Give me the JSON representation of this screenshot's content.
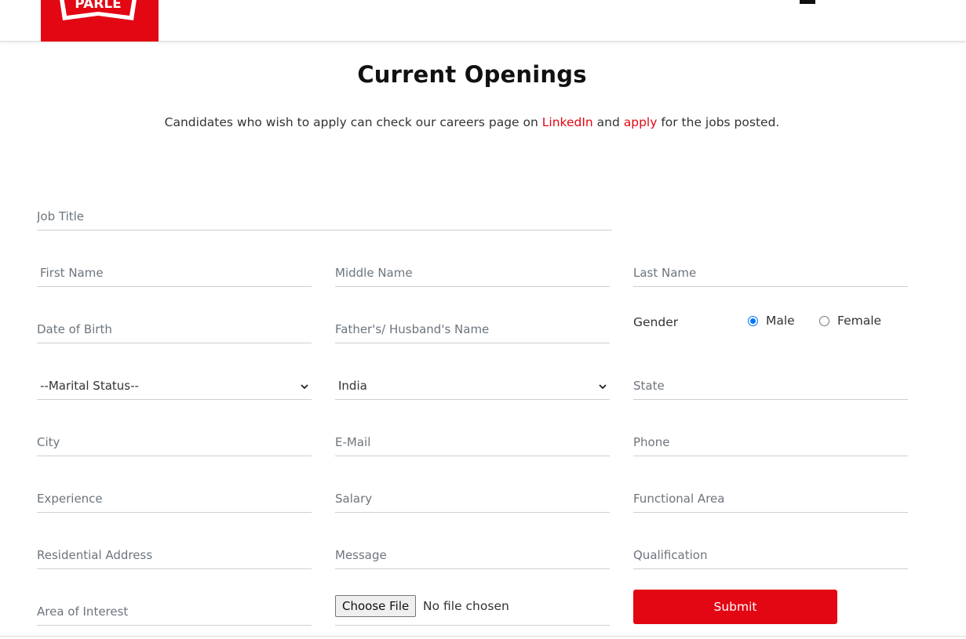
{
  "header": {
    "logo_text": "PARLE",
    "menu_icon": "hamburger-menu-icon",
    "brand_color": "#e30613"
  },
  "page": {
    "title": "Current Openings",
    "subtitle_before": "Candidates who wish to apply can check our careers page on ",
    "linkedin_link": "LinkedIn",
    "subtitle_middle": " and ",
    "apply_link": "apply",
    "subtitle_after": " for the jobs posted."
  },
  "form": {
    "job_title": "Job Title",
    "first_name": "First Name",
    "middle_name": "Middle Name",
    "last_name": "Last Name",
    "dob": "Date of Birth",
    "father_husband": "Father's/ Husband's Name",
    "gender_label": "Gender",
    "gender_options": [
      "Male",
      "Female"
    ],
    "gender_selected": "Male",
    "marital_status": "--Marital Status--",
    "country": "India",
    "state": "State",
    "city": "City",
    "email": "E-Mail",
    "phone": "Phone",
    "experience": "Experience",
    "salary": "Salary",
    "functional_area": "Functional Area",
    "residential_address": "Residential Address",
    "message": "Message",
    "qualification": "Qualification",
    "area_of_interest": "Area of Interest",
    "file_button": "Choose File",
    "file_status": "No file chosen",
    "submit": "Submit"
  }
}
